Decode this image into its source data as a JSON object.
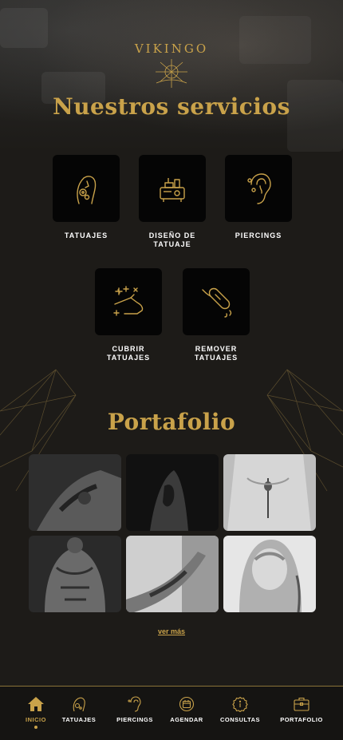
{
  "brand": {
    "name": "VIKINGO",
    "accent": "#c9a24a"
  },
  "services": {
    "title": "Nuestros servicios",
    "items": [
      {
        "label": "TATUAJES",
        "icon": "tattoo-arm-icon"
      },
      {
        "label": "DISEÑO DE\nTATUAJE",
        "icon": "tattoo-machine-icon"
      },
      {
        "label": "PIERCINGS",
        "icon": "ear-piercing-icon"
      },
      {
        "label": "CUBRIR\nTATUAJES",
        "icon": "cover-tattoo-hand-icon"
      },
      {
        "label": "REMOVER\nTATUAJES",
        "icon": "laser-removal-icon"
      }
    ]
  },
  "portfolio": {
    "title": "Portafolio",
    "more_label": "ver más",
    "photo_count": 6
  },
  "nav": {
    "items": [
      {
        "label": "INICIO",
        "icon": "home-icon",
        "active": true
      },
      {
        "label": "TATUAJES",
        "icon": "tattoo-icon",
        "active": false
      },
      {
        "label": "PIERCINGS",
        "icon": "ear-icon",
        "active": false
      },
      {
        "label": "AGENDAR",
        "icon": "calendar-badge-icon",
        "active": false
      },
      {
        "label": "CONSULTAS",
        "icon": "info-badge-icon",
        "active": false
      },
      {
        "label": "PORTAFOLIO",
        "icon": "briefcase-icon",
        "active": false
      }
    ]
  }
}
